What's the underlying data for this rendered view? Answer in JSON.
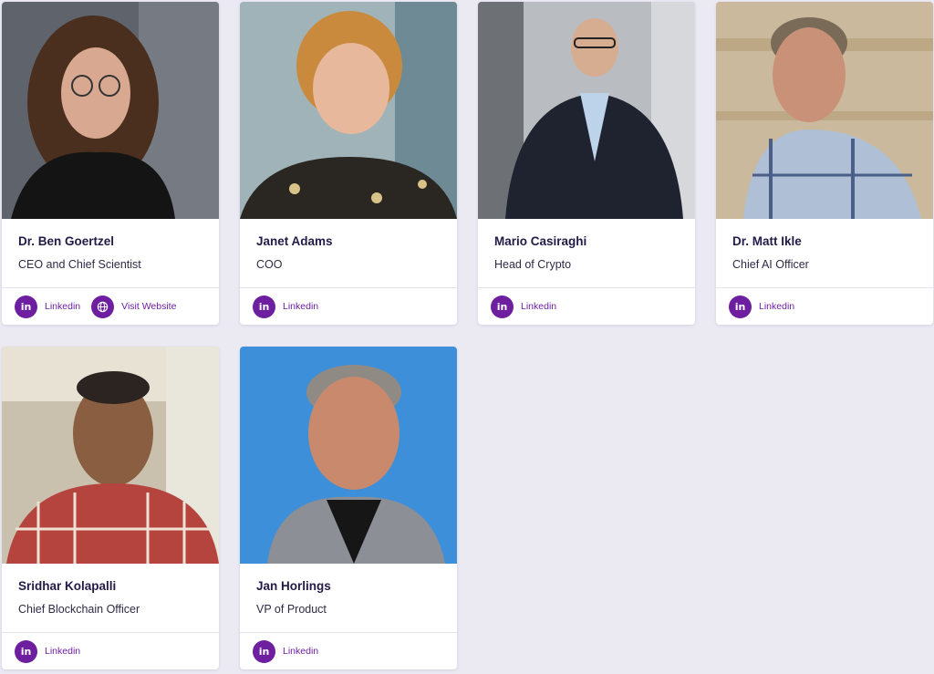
{
  "colors": {
    "accent": "#6d1fa0",
    "name_text": "#231a48",
    "background": "#ebeaf3"
  },
  "team": [
    {
      "name": "Dr. Ben Goertzel",
      "role": "CEO and Chief Scientist",
      "links": [
        {
          "label": "Linkedin",
          "icon": "linkedin-icon"
        },
        {
          "label": "Visit Website",
          "icon": "globe-icon"
        }
      ]
    },
    {
      "name": "Janet Adams",
      "role": "COO",
      "links": [
        {
          "label": "Linkedin",
          "icon": "linkedin-icon"
        }
      ]
    },
    {
      "name": "Mario Casiraghi",
      "role": "Head of Crypto",
      "links": [
        {
          "label": "Linkedin",
          "icon": "linkedin-icon"
        }
      ]
    },
    {
      "name": "Dr. Matt Ikle",
      "role": "Chief AI Officer",
      "links": [
        {
          "label": "Linkedin",
          "icon": "linkedin-icon"
        }
      ]
    },
    {
      "name": "Sridhar Kolapalli",
      "role": "Chief Blockchain Officer",
      "links": [
        {
          "label": "Linkedin",
          "icon": "linkedin-icon"
        }
      ]
    },
    {
      "name": "Jan Horlings",
      "role": "VP of Product",
      "links": [
        {
          "label": "Linkedin",
          "icon": "linkedin-icon"
        }
      ]
    }
  ]
}
